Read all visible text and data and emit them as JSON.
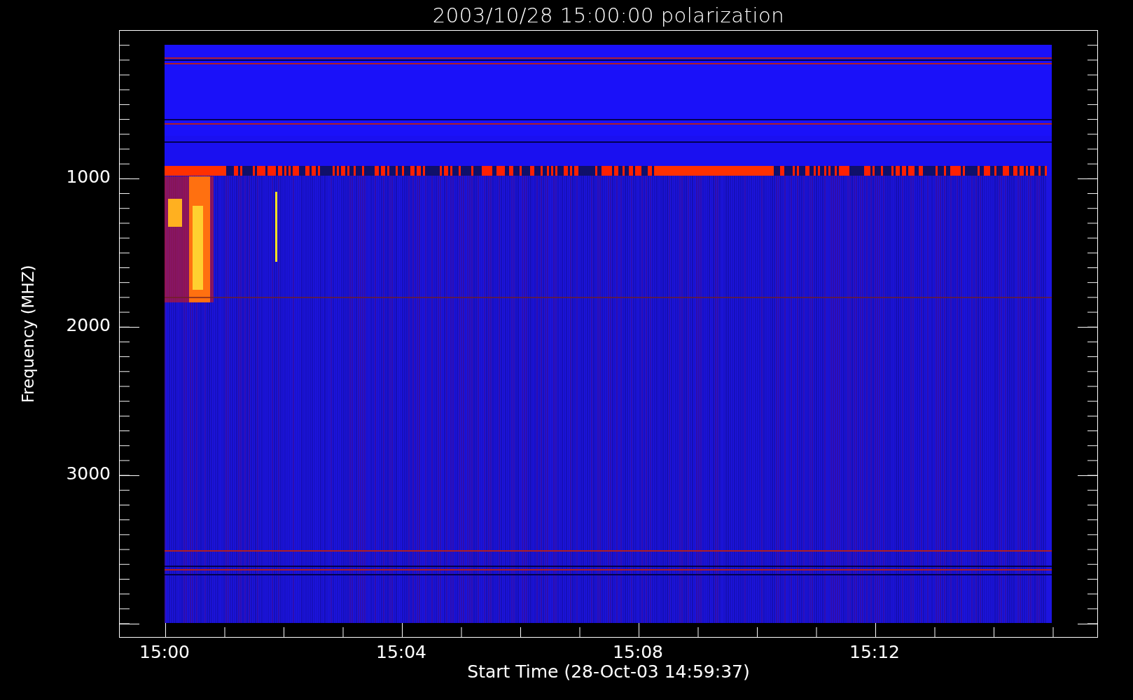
{
  "title": "2003/10/28 15:00:00 polarization",
  "y_axis": {
    "label": "Frequency (MHZ)",
    "ticks": [
      "1000",
      "2000",
      "3000"
    ]
  },
  "x_axis": {
    "label": "Start Time (28-Oct-03 14:59:37)",
    "ticks": [
      "15:00",
      "15:04",
      "15:08",
      "15:12"
    ]
  }
}
